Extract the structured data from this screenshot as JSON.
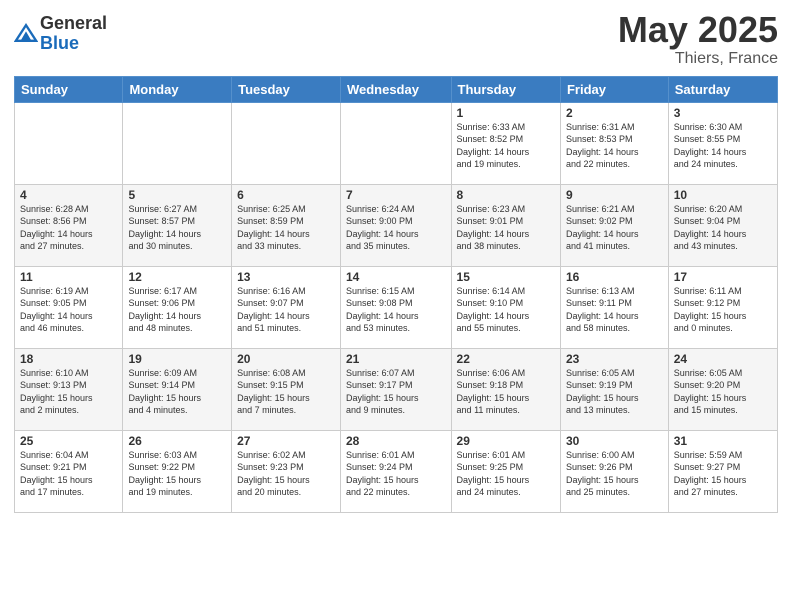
{
  "header": {
    "logo": {
      "general": "General",
      "blue": "Blue"
    },
    "month": "May 2025",
    "location": "Thiers, France"
  },
  "weekdays": [
    "Sunday",
    "Monday",
    "Tuesday",
    "Wednesday",
    "Thursday",
    "Friday",
    "Saturday"
  ],
  "weeks": [
    [
      {
        "day": "",
        "info": ""
      },
      {
        "day": "",
        "info": ""
      },
      {
        "day": "",
        "info": ""
      },
      {
        "day": "",
        "info": ""
      },
      {
        "day": "1",
        "info": "Sunrise: 6:33 AM\nSunset: 8:52 PM\nDaylight: 14 hours\nand 19 minutes."
      },
      {
        "day": "2",
        "info": "Sunrise: 6:31 AM\nSunset: 8:53 PM\nDaylight: 14 hours\nand 22 minutes."
      },
      {
        "day": "3",
        "info": "Sunrise: 6:30 AM\nSunset: 8:55 PM\nDaylight: 14 hours\nand 24 minutes."
      }
    ],
    [
      {
        "day": "4",
        "info": "Sunrise: 6:28 AM\nSunset: 8:56 PM\nDaylight: 14 hours\nand 27 minutes."
      },
      {
        "day": "5",
        "info": "Sunrise: 6:27 AM\nSunset: 8:57 PM\nDaylight: 14 hours\nand 30 minutes."
      },
      {
        "day": "6",
        "info": "Sunrise: 6:25 AM\nSunset: 8:59 PM\nDaylight: 14 hours\nand 33 minutes."
      },
      {
        "day": "7",
        "info": "Sunrise: 6:24 AM\nSunset: 9:00 PM\nDaylight: 14 hours\nand 35 minutes."
      },
      {
        "day": "8",
        "info": "Sunrise: 6:23 AM\nSunset: 9:01 PM\nDaylight: 14 hours\nand 38 minutes."
      },
      {
        "day": "9",
        "info": "Sunrise: 6:21 AM\nSunset: 9:02 PM\nDaylight: 14 hours\nand 41 minutes."
      },
      {
        "day": "10",
        "info": "Sunrise: 6:20 AM\nSunset: 9:04 PM\nDaylight: 14 hours\nand 43 minutes."
      }
    ],
    [
      {
        "day": "11",
        "info": "Sunrise: 6:19 AM\nSunset: 9:05 PM\nDaylight: 14 hours\nand 46 minutes."
      },
      {
        "day": "12",
        "info": "Sunrise: 6:17 AM\nSunset: 9:06 PM\nDaylight: 14 hours\nand 48 minutes."
      },
      {
        "day": "13",
        "info": "Sunrise: 6:16 AM\nSunset: 9:07 PM\nDaylight: 14 hours\nand 51 minutes."
      },
      {
        "day": "14",
        "info": "Sunrise: 6:15 AM\nSunset: 9:08 PM\nDaylight: 14 hours\nand 53 minutes."
      },
      {
        "day": "15",
        "info": "Sunrise: 6:14 AM\nSunset: 9:10 PM\nDaylight: 14 hours\nand 55 minutes."
      },
      {
        "day": "16",
        "info": "Sunrise: 6:13 AM\nSunset: 9:11 PM\nDaylight: 14 hours\nand 58 minutes."
      },
      {
        "day": "17",
        "info": "Sunrise: 6:11 AM\nSunset: 9:12 PM\nDaylight: 15 hours\nand 0 minutes."
      }
    ],
    [
      {
        "day": "18",
        "info": "Sunrise: 6:10 AM\nSunset: 9:13 PM\nDaylight: 15 hours\nand 2 minutes."
      },
      {
        "day": "19",
        "info": "Sunrise: 6:09 AM\nSunset: 9:14 PM\nDaylight: 15 hours\nand 4 minutes."
      },
      {
        "day": "20",
        "info": "Sunrise: 6:08 AM\nSunset: 9:15 PM\nDaylight: 15 hours\nand 7 minutes."
      },
      {
        "day": "21",
        "info": "Sunrise: 6:07 AM\nSunset: 9:17 PM\nDaylight: 15 hours\nand 9 minutes."
      },
      {
        "day": "22",
        "info": "Sunrise: 6:06 AM\nSunset: 9:18 PM\nDaylight: 15 hours\nand 11 minutes."
      },
      {
        "day": "23",
        "info": "Sunrise: 6:05 AM\nSunset: 9:19 PM\nDaylight: 15 hours\nand 13 minutes."
      },
      {
        "day": "24",
        "info": "Sunrise: 6:05 AM\nSunset: 9:20 PM\nDaylight: 15 hours\nand 15 minutes."
      }
    ],
    [
      {
        "day": "25",
        "info": "Sunrise: 6:04 AM\nSunset: 9:21 PM\nDaylight: 15 hours\nand 17 minutes."
      },
      {
        "day": "26",
        "info": "Sunrise: 6:03 AM\nSunset: 9:22 PM\nDaylight: 15 hours\nand 19 minutes."
      },
      {
        "day": "27",
        "info": "Sunrise: 6:02 AM\nSunset: 9:23 PM\nDaylight: 15 hours\nand 20 minutes."
      },
      {
        "day": "28",
        "info": "Sunrise: 6:01 AM\nSunset: 9:24 PM\nDaylight: 15 hours\nand 22 minutes."
      },
      {
        "day": "29",
        "info": "Sunrise: 6:01 AM\nSunset: 9:25 PM\nDaylight: 15 hours\nand 24 minutes."
      },
      {
        "day": "30",
        "info": "Sunrise: 6:00 AM\nSunset: 9:26 PM\nDaylight: 15 hours\nand 25 minutes."
      },
      {
        "day": "31",
        "info": "Sunrise: 5:59 AM\nSunset: 9:27 PM\nDaylight: 15 hours\nand 27 minutes."
      }
    ]
  ]
}
